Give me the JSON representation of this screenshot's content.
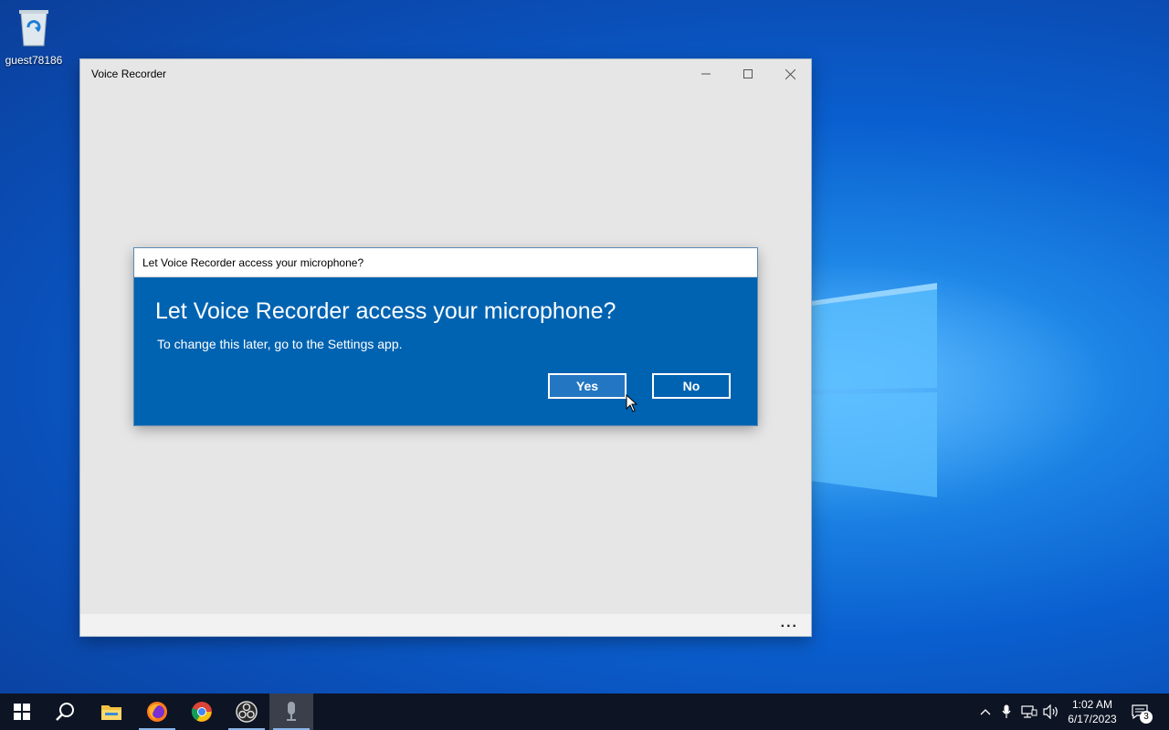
{
  "desktop": {
    "icons": [
      {
        "label": "guest78186",
        "icon": "recycle-bin-icon"
      }
    ]
  },
  "window": {
    "title": "Voice Recorder",
    "controls": [
      "minimize-icon",
      "maximize-icon",
      "close-icon"
    ],
    "more_label": "..."
  },
  "dialog": {
    "title": "Let Voice Recorder access your microphone?",
    "heading": "Let Voice Recorder access your microphone?",
    "text": "To change this later, go to the Settings app.",
    "yes_label": "Yes",
    "no_label": "No",
    "accent": "#0063b1"
  },
  "taskbar": {
    "items": [
      "start-icon",
      "search-icon",
      "file-explorer-icon",
      "firefox-icon",
      "chrome-icon",
      "obs-icon",
      "voice-recorder-icon"
    ],
    "active_item": "voice-recorder-icon",
    "tray": [
      "chevron-up-icon",
      "microphone-icon",
      "network-icon",
      "volume-icon"
    ],
    "time": "1:02 AM",
    "date": "6/17/2023",
    "notifications": "3"
  }
}
